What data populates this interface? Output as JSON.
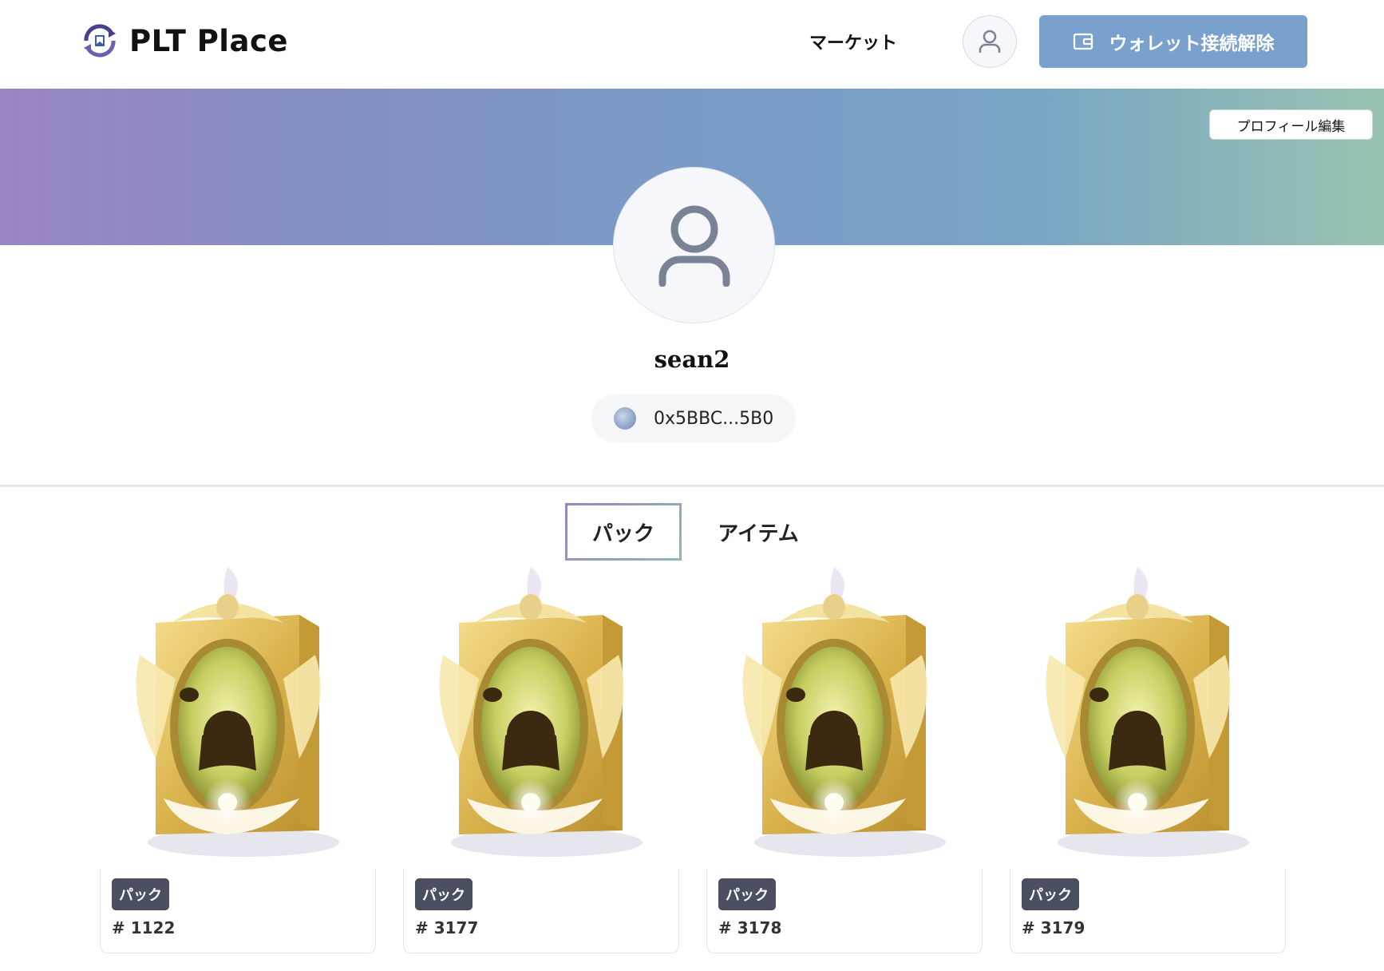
{
  "header": {
    "logo_text": "PLT Place",
    "nav_market": "マーケット",
    "wallet_button_label": "ウォレット接続解除"
  },
  "profile": {
    "edit_button_label": "プロフィール編集",
    "username": "sean2",
    "address": "0x5BBC...5B0"
  },
  "tabs": [
    {
      "label": "パック",
      "active": true
    },
    {
      "label": "アイテム",
      "active": false
    }
  ],
  "cards": [
    {
      "badge": "パック",
      "token": "# 1122"
    },
    {
      "badge": "パック",
      "token": "# 3177"
    },
    {
      "badge": "パック",
      "token": "# 3178"
    },
    {
      "badge": "パック",
      "token": "# 3179"
    }
  ],
  "colors": {
    "accent": "#7aa1cd",
    "banner_start": "#9a86c0",
    "banner_end": "#98c3b0",
    "badge_bg": "#4a5062"
  }
}
